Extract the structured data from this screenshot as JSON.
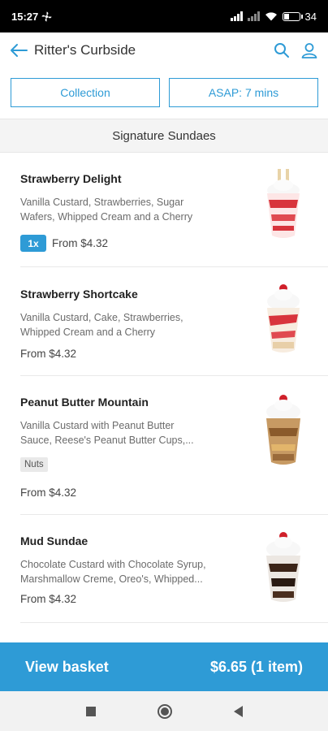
{
  "status_bar": {
    "time": "15:27",
    "battery": "34",
    "battery_level": 0.34
  },
  "header": {
    "title": "Ritter's Curbside",
    "back_icon": "arrow-left-icon",
    "search_icon": "search-icon",
    "account_icon": "person-icon"
  },
  "options": {
    "collection_label": "Collection",
    "time_label": "ASAP: 7 mins"
  },
  "section": {
    "title": "Signature Sundaes"
  },
  "items": [
    {
      "name": "Strawberry Delight",
      "desc_line1": "Vanilla Custard, Strawberries, Sugar",
      "desc_line2": "Wafers, Whipped Cream and a Cherry",
      "qty": "1x",
      "price": "From $4.32",
      "tag": ""
    },
    {
      "name": "Strawberry Shortcake",
      "desc_line1": "Vanilla Custard, Cake, Strawberries,",
      "desc_line2": "Whipped Cream and a Cherry",
      "qty": "",
      "price": "From $4.32",
      "tag": ""
    },
    {
      "name": "Peanut Butter Mountain",
      "desc_line1": "Vanilla Custard with Peanut Butter",
      "desc_line2": "Sauce, Reese's Peanut Butter Cups,...",
      "qty": "",
      "price": "From $4.32",
      "tag": "Nuts"
    },
    {
      "name": "Mud Sundae",
      "desc_line1": "Chocolate Custard with Chocolate Syrup,",
      "desc_line2": "Marshmallow Creme, Oreo's, Whipped...",
      "qty": "",
      "price": "From $4.32",
      "tag": ""
    }
  ],
  "basket": {
    "label": "View basket",
    "total": "$6.65 (1 item)"
  },
  "colors": {
    "accent": "#2e9bd6"
  }
}
